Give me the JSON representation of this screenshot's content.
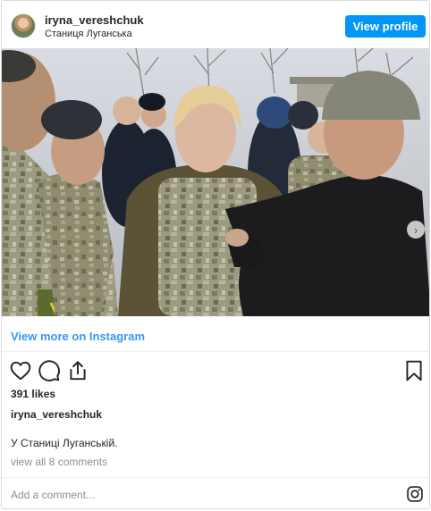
{
  "header": {
    "username": "iryna_vereshchuk",
    "location": "Станиця Луганська",
    "view_profile_label": "View profile",
    "accent_color": "#0095f6"
  },
  "post": {
    "carousel_dots": 2,
    "active_dot": 1,
    "next_icon": "chevron-right-icon"
  },
  "links": {
    "view_more": "View more on Instagram",
    "link_color": "#3897f0"
  },
  "actions": {
    "icons": [
      "heart-icon",
      "comment-icon",
      "share-icon",
      "bookmark-icon"
    ]
  },
  "stats": {
    "likes": "391 likes"
  },
  "caption": {
    "username": "iryna_vereshchuk",
    "text": "У Станиці Луганській.",
    "view_comments": "view all 8 comments"
  },
  "comment_box": {
    "placeholder": "Add a comment...",
    "icon": "instagram-icon"
  }
}
